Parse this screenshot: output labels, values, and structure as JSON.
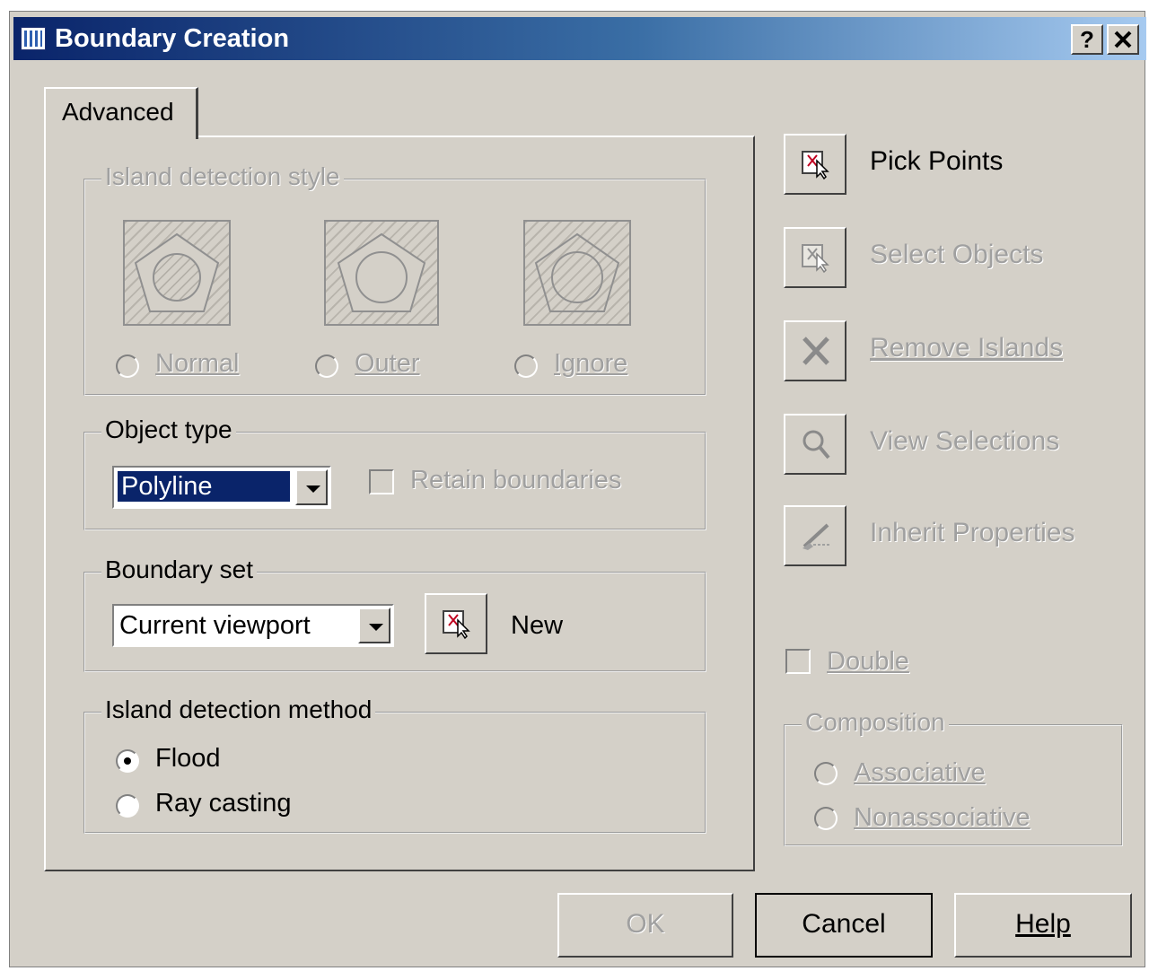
{
  "window": {
    "title": "Boundary Creation",
    "help_button": "?",
    "close_button": "✕"
  },
  "tab": {
    "label": "Advanced"
  },
  "island_style": {
    "label": "Island detection style",
    "options": [
      {
        "label": "Normal"
      },
      {
        "label": "Outer"
      },
      {
        "label": "Ignore"
      }
    ]
  },
  "object_type": {
    "label": "Object type",
    "selected": "Polyline",
    "retain_label": "Retain boundaries"
  },
  "boundary_set": {
    "label": "Boundary set",
    "selected": "Current viewport",
    "new_label": "New"
  },
  "island_method": {
    "label": "Island detection method",
    "options": [
      {
        "label": "Flood",
        "checked": true
      },
      {
        "label": "Ray casting",
        "checked": false
      }
    ]
  },
  "actions": [
    {
      "label": "Pick Points",
      "icon": "pick-points-icon",
      "enabled": true
    },
    {
      "label": "Select Objects",
      "icon": "select-objects-icon",
      "enabled": false
    },
    {
      "label": "Remove Islands",
      "icon": "remove-islands-icon",
      "enabled": false
    },
    {
      "label": "View Selections",
      "icon": "magnifier-icon",
      "enabled": false
    },
    {
      "label": "Inherit Properties",
      "icon": "inherit-properties-icon",
      "enabled": false
    }
  ],
  "double": {
    "label": "Double"
  },
  "composition": {
    "label": "Composition",
    "options": [
      {
        "label": "Associative"
      },
      {
        "label": "Nonassociative"
      }
    ]
  },
  "buttons": {
    "ok": "OK",
    "cancel": "Cancel",
    "help": "Help"
  }
}
